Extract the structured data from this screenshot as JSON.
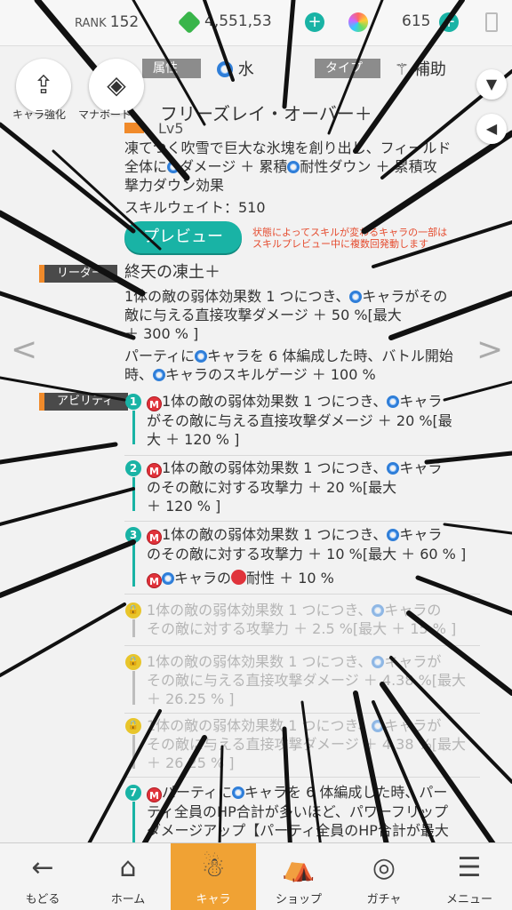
{
  "header": {
    "rank_label": "RANK",
    "rank_value": "152",
    "currency_green": "4,551,53",
    "currency_rainbow": "615",
    "colors": {
      "accent": "#19b3a5",
      "leader_tag": "#f08a2a",
      "water": "#2f7ed8",
      "active_nav": "#f0a234"
    }
  },
  "sidebar": {
    "enhance_label": "キャラ強化",
    "manaboard_label": "マナボード"
  },
  "skill": {
    "attr_label": "属性",
    "attr_value": "水",
    "type_label": "タイプ",
    "type_value": "補助",
    "name": "フリーズレイ・オーバー＋",
    "level": "Lv5",
    "desc_1": "凍てつく吹雪で巨大な氷塊を創り出し、フィールド",
    "desc_2a": "全体に",
    "desc_2b": "ダメージ ＋ 累積",
    "desc_2c": "耐性ダウン ＋ 累積攻",
    "desc_3": "撃力ダウン効果",
    "weight": "スキルウェイト：510",
    "preview_label": "プレビュー",
    "preview_note_1": "状態によってスキルが変わるキャラの一部は",
    "preview_note_2": "スキルプレビュー中に複数回発動します"
  },
  "leader": {
    "tag": "リーダー",
    "name": "終天の凍土＋",
    "line_1a": "1体の敵の弱体効果数 1 つにつき、",
    "line_1b": "キャラがその",
    "line_2": "敵に与える直接攻撃ダメージ ＋ 50 %[最大",
    "line_3": "＋ 300 % ]",
    "line_4a": "パーティに",
    "line_4b": "キャラを 6 体編成した時、バトル開始",
    "line_5a": "時、",
    "line_5b": "キャラのスキルゲージ ＋ 100 %"
  },
  "abilities": {
    "tag": "アビリティ",
    "items": [
      {
        "num": "1",
        "l1a": "1体の敵の弱体効果数 1 つにつき、",
        "l1b": "キャラ",
        "l2": "がその敵に与える直接攻撃ダメージ ＋ 20 %[最",
        "l3": "大 ＋ 120 % ]"
      },
      {
        "num": "2",
        "l1a": "1体の敵の弱体効果数 1 つにつき、",
        "l1b": "キャラ",
        "l2": "のその敵に対する攻撃力 ＋ 20 %[最大",
        "l3": "＋ 120 % ]"
      },
      {
        "num": "3",
        "l1a": "1体の敵の弱体効果数 1 つにつき、",
        "l1b": "キャラ",
        "l2": "のその敵に対する攻撃力 ＋ 10 %[最大 ＋ 60 % ]",
        "l3a": "キャラの",
        "l3b": "耐性 ＋ 10 %"
      },
      {
        "num": "",
        "l1a": "1体の敵の弱体効果数 1 つにつき、",
        "l1b": "キャラの",
        "l2": "その敵に対する攻撃力 ＋ 2.5 %[最大 ＋ 15 % ]"
      },
      {
        "num": "",
        "l1a": "1体の敵の弱体効果数 1 つにつき、",
        "l1b": "キャラが",
        "l2": "その敵に与える直接攻撃ダメージ ＋ 4.38 %[最大",
        "l3": "＋ 26.25 % ]"
      },
      {
        "num": "",
        "l1a": "1体の敵の弱体効果数 1 つにつき、",
        "l1b": "キャラが",
        "l2": "その敵に与える直接攻撃ダメージ ＋ 4.38 %[最大",
        "l3": "＋ 26.25 % ]"
      },
      {
        "num": "7",
        "l1a": "パーティに",
        "l1b": "キャラを 6 体編成した時、パー",
        "l2": "ティ全員のHP合計が多いほど、パワーフリップ",
        "l3": "ダメージアップ【パーティ全員のHP合計が最大"
      }
    ]
  },
  "nav": {
    "back": "もどる",
    "home": "ホーム",
    "chara": "キャラ",
    "shop": "ショップ",
    "gacha": "ガチャ",
    "menu": "メニュー"
  },
  "icons": {
    "back": "arrow-left-icon",
    "home": "home-icon",
    "chara": "character-icon",
    "shop": "shop-icon",
    "gacha": "gacha-icon",
    "menu": "menu-icon"
  }
}
